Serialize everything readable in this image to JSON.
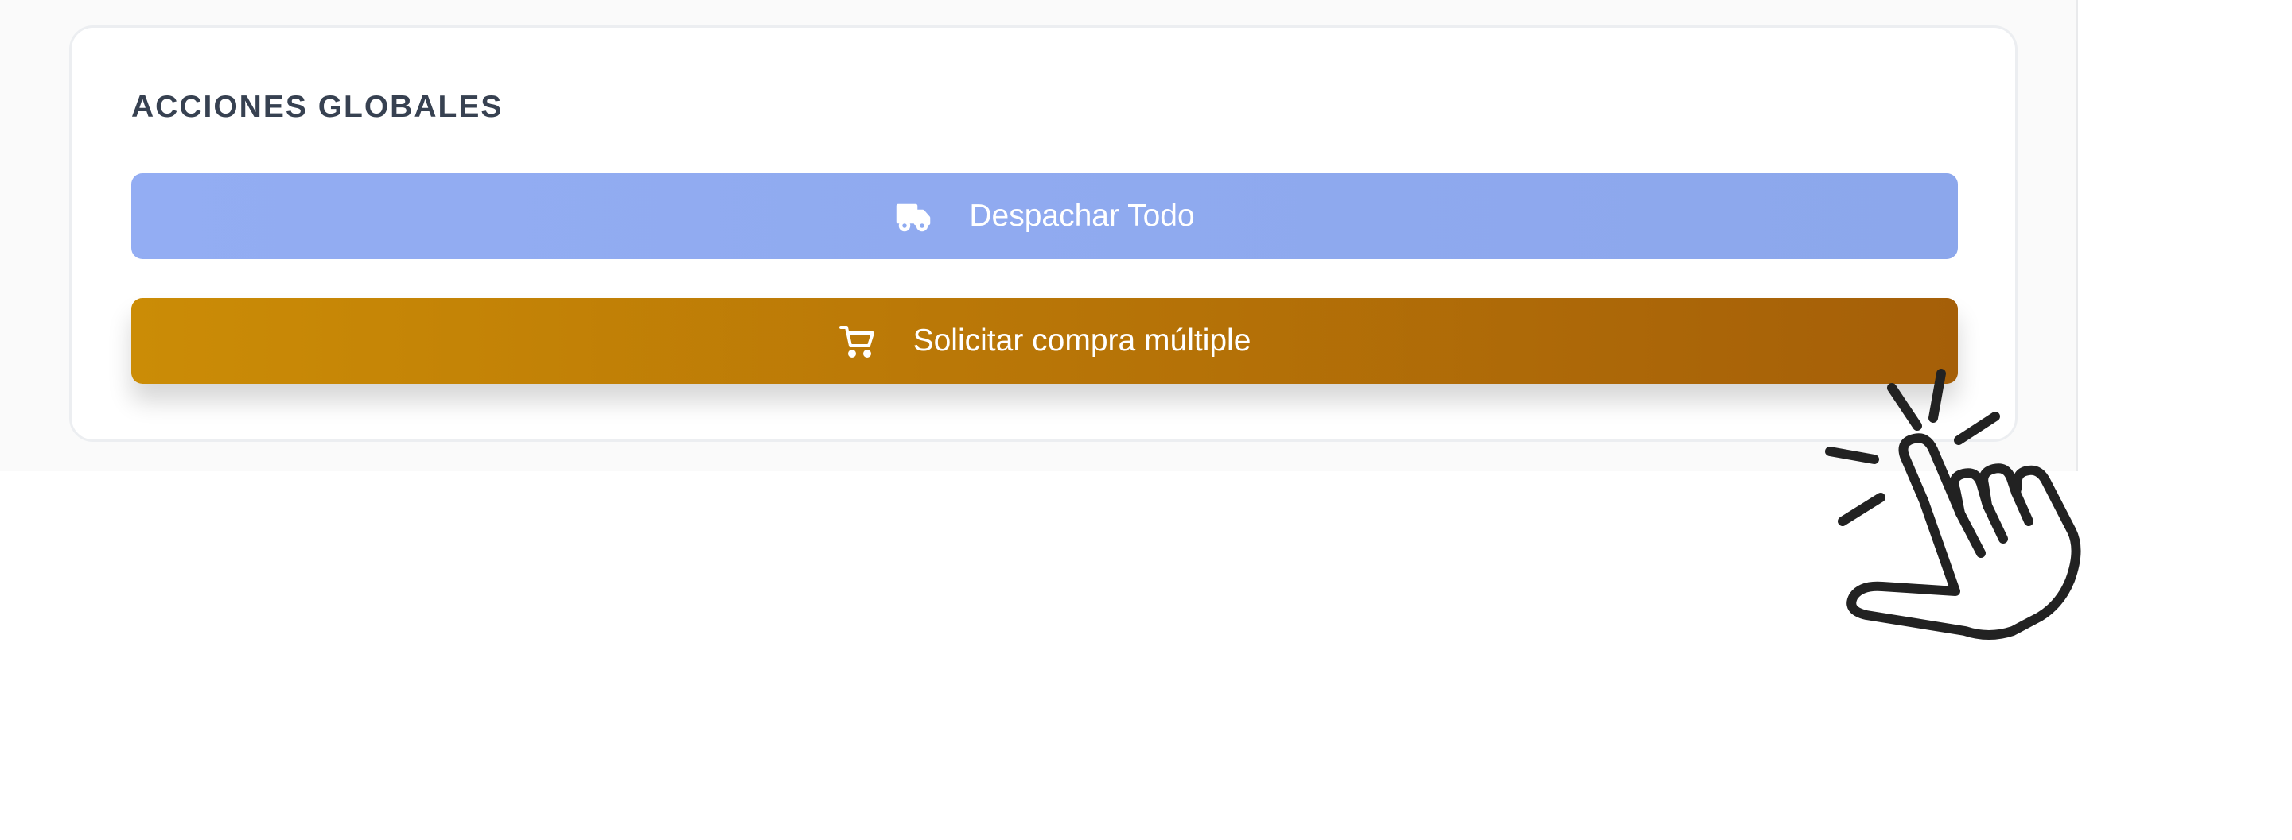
{
  "actions_card": {
    "title": "ACCIONES GLOBALES",
    "dispatch_all_label": "Despachar Todo",
    "multi_purchase_label": "Solicitar compra múltiple"
  },
  "icons": {
    "dispatch": "truck-icon",
    "purchase": "cart-icon",
    "cursor": "hand-click-cursor-icon"
  },
  "colors": {
    "dispatch_button": "#8FABF1",
    "purchase_button_start": "#CB8C06",
    "purchase_button_end": "#A55F08",
    "title_text": "#374151"
  }
}
